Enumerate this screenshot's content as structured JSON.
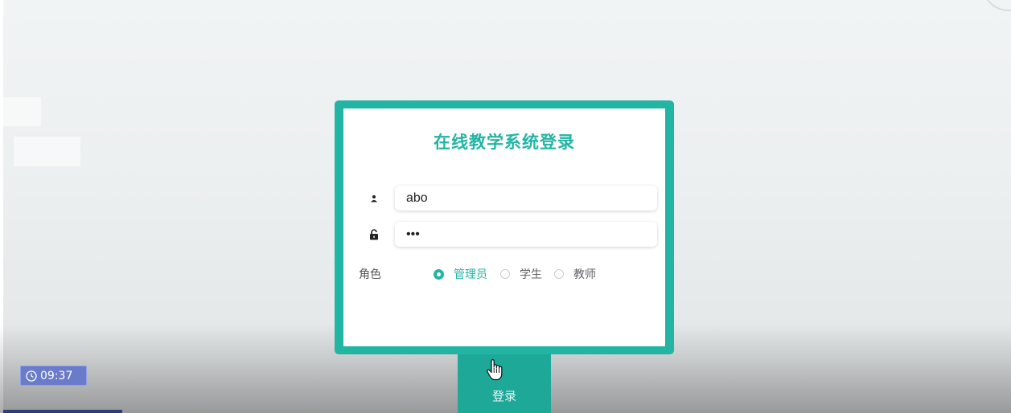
{
  "timer": {
    "time": "09:37",
    "icon": "clock-icon"
  },
  "login": {
    "title": "在线教学系统登录",
    "username": {
      "value": "abo",
      "icon": "user-icon"
    },
    "password": {
      "value": "abc",
      "icon": "lock-icon"
    },
    "role": {
      "label": "角色",
      "options": [
        "管理员",
        "学生",
        "教师"
      ],
      "selected": "管理员"
    },
    "submit_label": "登录"
  },
  "colors": {
    "accent": "#22b5a4",
    "button": "#1ea898",
    "timer_badge": "#6a7bc9"
  }
}
